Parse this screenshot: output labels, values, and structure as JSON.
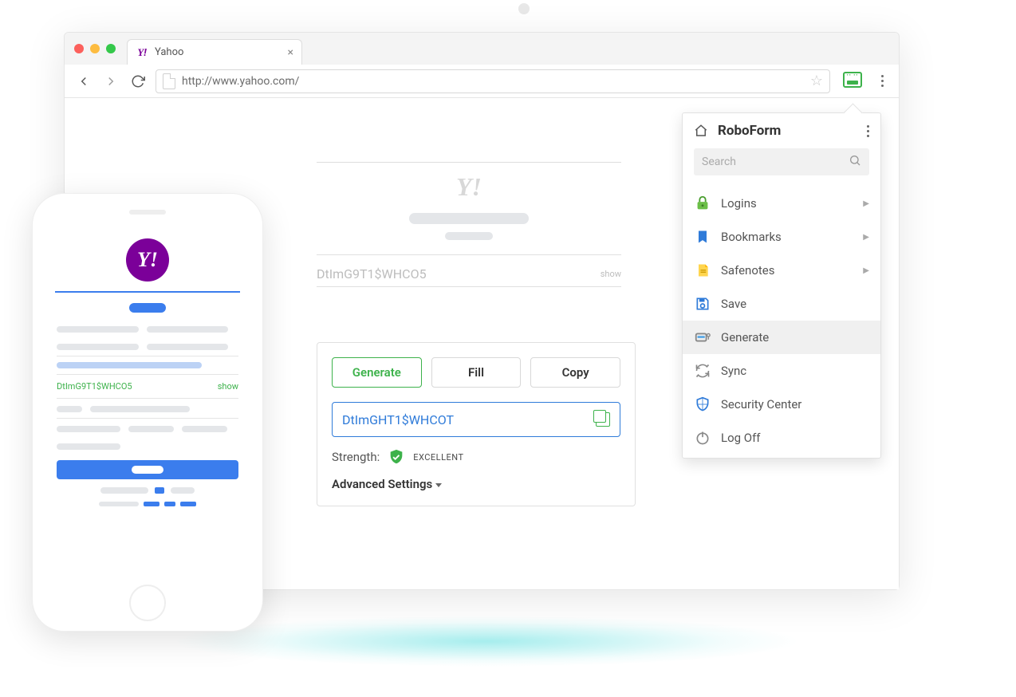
{
  "window": {
    "top_dot": true
  },
  "browser": {
    "tab_title": "Yahoo",
    "url": "http://www.yahoo.com/"
  },
  "yahoo_form": {
    "placeholder_password": "DtImG9T1$WHCO5",
    "show_label": "show"
  },
  "generator": {
    "generate_label": "Generate",
    "fill_label": "Fill",
    "copy_label": "Copy",
    "generated_password": "DtImGHT1$WHCOT",
    "strength_label": "Strength:",
    "strength_value": "EXCELLENT",
    "advanced_label": "Advanced Settings"
  },
  "popup": {
    "title": "RoboForm",
    "search_placeholder": "Search",
    "items": {
      "logins": "Logins",
      "bookmarks": "Bookmarks",
      "safenotes": "Safenotes",
      "save": "Save",
      "generate": "Generate",
      "sync": "Sync",
      "security": "Security Center",
      "logoff": "Log Off"
    }
  },
  "phone": {
    "password_value": "DtImG9T1$WHCO5",
    "show_label": "show"
  },
  "colors": {
    "green": "#3db24b",
    "blue": "#2f7bd9",
    "purple": "#7b0099",
    "grey": "#e4e6e9"
  }
}
